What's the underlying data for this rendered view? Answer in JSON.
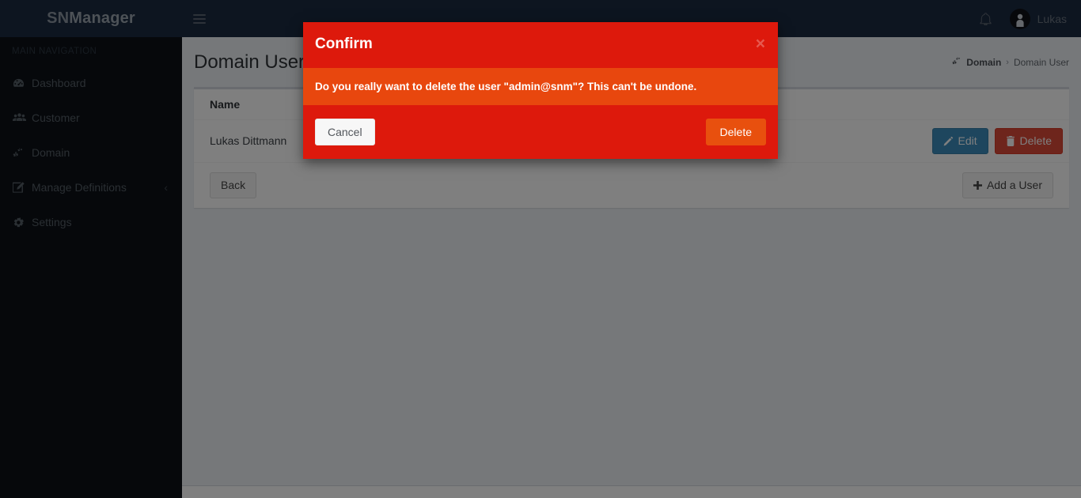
{
  "app": {
    "brand_prefix": "SN",
    "brand_suffix": "Manager"
  },
  "sidebar": {
    "section_header": "MAIN NAVIGATION",
    "items": [
      {
        "label": "Dashboard",
        "icon": "dashboard-icon"
      },
      {
        "label": "Customer",
        "icon": "users-icon"
      },
      {
        "label": "Domain",
        "icon": "cogs-icon"
      },
      {
        "label": "Manage Definitions",
        "icon": "edit-icon",
        "caret": "‹"
      },
      {
        "label": "Settings",
        "icon": "gear-icon"
      }
    ]
  },
  "header": {
    "menu_toggle": "menu-toggle",
    "bell": "notifications-bell",
    "user_name": "Lukas"
  },
  "content": {
    "page_title": "Domain User",
    "breadcrumb": {
      "parent": "Domain",
      "separator": "›",
      "current": "Domain User"
    },
    "table": {
      "columns": [
        "Name"
      ],
      "rows": [
        {
          "name": "Lukas Dittmann",
          "edit_label": "Edit",
          "delete_label": "Delete"
        }
      ]
    },
    "footer": {
      "back_label": "Back",
      "add_user_label": "Add a User",
      "add_user_prefix": ""
    }
  },
  "modal": {
    "title": "Confirm",
    "close_label": "×",
    "message": "Do you really want to delete the user \"admin@snm\"? This can't be undone.",
    "cancel_label": "Cancel",
    "delete_label": "Delete"
  },
  "colors": {
    "sidebar_bg": "#0d1117",
    "header_bg": "#1b2a41",
    "content_bg": "#ecf0f5",
    "modal_header_bg": "#dd190c",
    "modal_body_bg": "#e8470e",
    "modal_delete_btn": "#e8500e",
    "edit_btn": "#3c8dbc",
    "delete_btn": "#dd4b39"
  }
}
